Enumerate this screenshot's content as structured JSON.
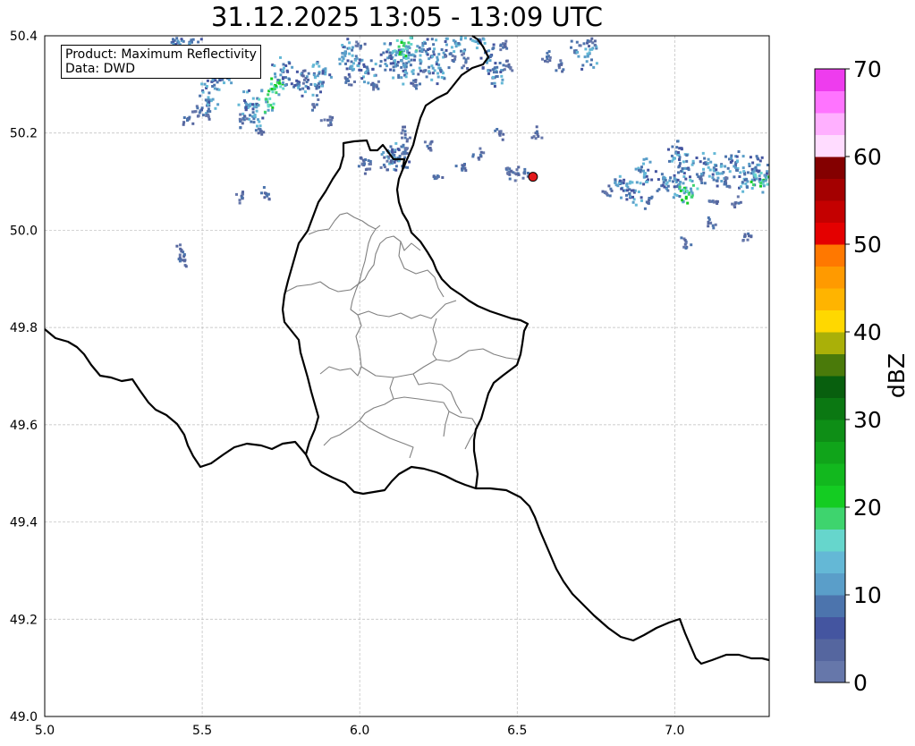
{
  "title": "31.12.2025 13:05 - 13:09 UTC",
  "info_box": {
    "product": "Product: Maximum Reflectivity",
    "data": "Data: DWD"
  },
  "map": {
    "lon_range": [
      5.0,
      7.3
    ],
    "lat_range": [
      49.0,
      50.4
    ],
    "lon_ticks": [
      "5.0",
      "5.5",
      "6.0",
      "6.5",
      "7.0"
    ],
    "lat_ticks": [
      "49.0",
      "49.2",
      "49.4",
      "49.6",
      "49.8",
      "50.0",
      "50.2",
      "50.4"
    ],
    "gridlines": true,
    "marker": {
      "lon": 6.55,
      "lat": 50.11,
      "color": "#e31a1c"
    },
    "border_color": "#000000",
    "subdivision_color": "#808080"
  },
  "colorbar": {
    "label": "dBZ",
    "ticks": [
      "0",
      "10",
      "20",
      "30",
      "40",
      "50",
      "60",
      "70"
    ],
    "range": [
      0,
      70
    ],
    "step": 2.5,
    "colors": [
      "#6677aa",
      "#55669f",
      "#4455a0",
      "#4c74ad",
      "#5a9ec9",
      "#64b8d6",
      "#66d6cc",
      "#3ed46e",
      "#14cc22",
      "#12b81e",
      "#10a41a",
      "#0e8e16",
      "#0b7812",
      "#085f0e",
      "#4a7a0a",
      "#aab008",
      "#ffd800",
      "#ffb400",
      "#ff9a00",
      "#ff7800",
      "#e40000",
      "#c40000",
      "#a40000",
      "#840000",
      "#ffdcff",
      "#ffb0ff",
      "#ff74ff",
      "#ee3cee"
    ]
  },
  "echoes": [
    {
      "lon": 5.42,
      "lat": 50.39,
      "s": "m"
    },
    {
      "lon": 5.46,
      "lat": 50.39,
      "s": "m"
    },
    {
      "lon": 5.53,
      "lat": 50.31,
      "s": "m"
    },
    {
      "lon": 5.52,
      "lat": 50.27,
      "s": "m"
    },
    {
      "lon": 5.56,
      "lat": 50.32,
      "s": "m"
    },
    {
      "lon": 5.51,
      "lat": 50.24,
      "s": "l"
    },
    {
      "lon": 5.48,
      "lat": 50.25,
      "s": "l"
    },
    {
      "lon": 5.45,
      "lat": 50.23,
      "s": "l"
    },
    {
      "lon": 5.64,
      "lat": 50.26,
      "s": "m"
    },
    {
      "lon": 5.66,
      "lat": 50.24,
      "s": "m"
    },
    {
      "lon": 5.7,
      "lat": 50.27,
      "s": "h"
    },
    {
      "lon": 5.73,
      "lat": 50.3,
      "s": "h"
    },
    {
      "lon": 5.62,
      "lat": 50.23,
      "s": "l"
    },
    {
      "lon": 5.68,
      "lat": 50.21,
      "s": "l"
    },
    {
      "lon": 5.75,
      "lat": 50.33,
      "s": "m"
    },
    {
      "lon": 5.8,
      "lat": 50.3,
      "s": "m"
    },
    {
      "lon": 5.82,
      "lat": 50.32,
      "s": "l"
    },
    {
      "lon": 5.86,
      "lat": 50.3,
      "s": "m"
    },
    {
      "lon": 5.88,
      "lat": 50.33,
      "s": "m"
    },
    {
      "lon": 5.85,
      "lat": 50.26,
      "s": "l"
    },
    {
      "lon": 5.89,
      "lat": 50.23,
      "s": "l"
    },
    {
      "lon": 5.95,
      "lat": 50.37,
      "s": "m"
    },
    {
      "lon": 5.98,
      "lat": 50.35,
      "s": "m"
    },
    {
      "lon": 6.0,
      "lat": 50.38,
      "s": "l"
    },
    {
      "lon": 5.96,
      "lat": 50.31,
      "s": "l"
    },
    {
      "lon": 6.02,
      "lat": 50.33,
      "s": "m"
    },
    {
      "lon": 6.04,
      "lat": 50.3,
      "s": "l"
    },
    {
      "lon": 6.09,
      "lat": 50.36,
      "s": "m"
    },
    {
      "lon": 6.11,
      "lat": 50.34,
      "s": "m"
    },
    {
      "lon": 6.13,
      "lat": 50.37,
      "s": "h"
    },
    {
      "lon": 6.15,
      "lat": 50.38,
      "s": "h"
    },
    {
      "lon": 6.14,
      "lat": 50.33,
      "s": "m"
    },
    {
      "lon": 6.18,
      "lat": 50.36,
      "s": "m"
    },
    {
      "lon": 6.2,
      "lat": 50.33,
      "s": "l"
    },
    {
      "lon": 6.17,
      "lat": 50.3,
      "s": "l"
    },
    {
      "lon": 6.23,
      "lat": 50.37,
      "s": "m"
    },
    {
      "lon": 6.25,
      "lat": 50.33,
      "s": "m"
    },
    {
      "lon": 6.28,
      "lat": 50.36,
      "s": "l"
    },
    {
      "lon": 6.3,
      "lat": 50.39,
      "s": "m"
    },
    {
      "lon": 6.33,
      "lat": 50.35,
      "s": "l"
    },
    {
      "lon": 6.38,
      "lat": 50.39,
      "s": "m"
    },
    {
      "lon": 6.41,
      "lat": 50.36,
      "s": "m"
    },
    {
      "lon": 6.43,
      "lat": 50.32,
      "s": "m"
    },
    {
      "lon": 6.45,
      "lat": 50.38,
      "s": "l"
    },
    {
      "lon": 6.47,
      "lat": 50.34,
      "s": "l"
    },
    {
      "lon": 6.59,
      "lat": 50.36,
      "s": "l"
    },
    {
      "lon": 6.63,
      "lat": 50.34,
      "s": "l"
    },
    {
      "lon": 6.68,
      "lat": 50.38,
      "s": "l"
    },
    {
      "lon": 6.72,
      "lat": 50.36,
      "s": "m"
    },
    {
      "lon": 6.73,
      "lat": 50.39,
      "s": "l"
    },
    {
      "lon": 6.1,
      "lat": 50.16,
      "s": "m"
    },
    {
      "lon": 6.12,
      "lat": 50.15,
      "s": "m"
    },
    {
      "lon": 6.14,
      "lat": 50.17,
      "s": "l"
    },
    {
      "lon": 6.08,
      "lat": 50.14,
      "s": "l"
    },
    {
      "lon": 6.14,
      "lat": 50.2,
      "s": "l"
    },
    {
      "lon": 5.43,
      "lat": 49.96,
      "s": "l"
    },
    {
      "lon": 5.44,
      "lat": 49.94,
      "s": "l"
    },
    {
      "lon": 5.62,
      "lat": 50.07,
      "s": "l"
    },
    {
      "lon": 5.7,
      "lat": 50.08,
      "s": "l"
    },
    {
      "lon": 6.0,
      "lat": 50.15,
      "s": "l"
    },
    {
      "lon": 6.02,
      "lat": 50.13,
      "s": "l"
    },
    {
      "lon": 6.22,
      "lat": 50.18,
      "s": "l"
    },
    {
      "lon": 6.24,
      "lat": 50.11,
      "s": "l"
    },
    {
      "lon": 6.32,
      "lat": 50.13,
      "s": "l"
    },
    {
      "lon": 6.37,
      "lat": 50.16,
      "s": "l"
    },
    {
      "lon": 6.44,
      "lat": 50.2,
      "s": "l"
    },
    {
      "lon": 6.47,
      "lat": 50.12,
      "s": "l"
    },
    {
      "lon": 6.49,
      "lat": 50.12,
      "s": "l"
    },
    {
      "lon": 6.52,
      "lat": 50.12,
      "s": "l"
    },
    {
      "lon": 6.56,
      "lat": 50.2,
      "s": "l"
    },
    {
      "lon": 6.78,
      "lat": 50.08,
      "s": "l"
    },
    {
      "lon": 6.82,
      "lat": 50.1,
      "s": "m"
    },
    {
      "lon": 6.86,
      "lat": 50.08,
      "s": "m"
    },
    {
      "lon": 6.9,
      "lat": 50.12,
      "s": "m"
    },
    {
      "lon": 6.91,
      "lat": 50.06,
      "s": "l"
    },
    {
      "lon": 6.96,
      "lat": 50.11,
      "s": "m"
    },
    {
      "lon": 7.0,
      "lat": 50.16,
      "s": "m"
    },
    {
      "lon": 7.04,
      "lat": 50.13,
      "s": "m"
    },
    {
      "lon": 7.01,
      "lat": 50.09,
      "s": "m"
    },
    {
      "lon": 7.04,
      "lat": 50.08,
      "s": "h"
    },
    {
      "lon": 7.08,
      "lat": 50.11,
      "s": "l"
    },
    {
      "lon": 7.1,
      "lat": 50.14,
      "s": "m"
    },
    {
      "lon": 7.13,
      "lat": 50.12,
      "s": "m"
    },
    {
      "lon": 7.16,
      "lat": 50.1,
      "s": "l"
    },
    {
      "lon": 7.19,
      "lat": 50.14,
      "s": "m"
    },
    {
      "lon": 7.22,
      "lat": 50.11,
      "s": "m"
    },
    {
      "lon": 7.25,
      "lat": 50.13,
      "s": "m"
    },
    {
      "lon": 7.27,
      "lat": 50.1,
      "s": "h"
    },
    {
      "lon": 7.29,
      "lat": 50.12,
      "s": "m"
    },
    {
      "lon": 7.12,
      "lat": 50.06,
      "s": "l"
    },
    {
      "lon": 7.11,
      "lat": 50.02,
      "s": "l"
    },
    {
      "lon": 7.19,
      "lat": 50.06,
      "s": "l"
    },
    {
      "lon": 7.03,
      "lat": 49.98,
      "s": "l"
    },
    {
      "lon": 7.22,
      "lat": 49.99,
      "s": "l"
    }
  ]
}
